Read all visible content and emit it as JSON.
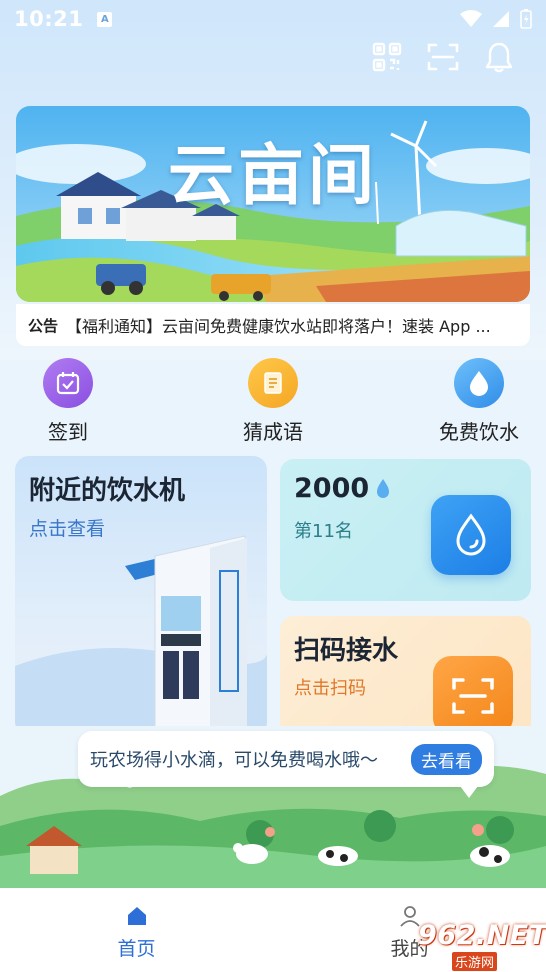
{
  "status_bar": {
    "time": "10:21",
    "notif_badge": "A"
  },
  "header": {
    "icons": [
      "qrcode-icon",
      "scan-icon",
      "bell-icon"
    ]
  },
  "banner": {
    "title": "云亩间"
  },
  "notice": {
    "label": "公告",
    "text": "【福利通知】云亩间免费健康饮水站即将落户！速装 App ..."
  },
  "quick_actions": [
    {
      "label": "签到",
      "icon": "calendar-check-icon",
      "color": "#8e55e0"
    },
    {
      "label": "猜成语",
      "icon": "book-icon",
      "color": "#f5a623"
    },
    {
      "label": "免费饮水",
      "icon": "water-drop-icon",
      "color": "#2f8de8"
    }
  ],
  "cards": {
    "nearby": {
      "title": "附近的饮水机",
      "subtitle": "点击查看"
    },
    "rank": {
      "value": "2000",
      "position": "第11名"
    },
    "scan": {
      "title": "扫码接水",
      "subtitle": "点击扫码"
    }
  },
  "tip": {
    "text": "玩农场得小水滴，可以免费喝水哦～",
    "button": "去看看"
  },
  "tabbar": {
    "tabs": [
      {
        "label": "首页",
        "icon": "home-icon",
        "active": true
      },
      {
        "label": "我的",
        "icon": "user-icon",
        "active": false
      }
    ]
  },
  "watermark": {
    "text": "962.NET",
    "sub": "乐游网"
  },
  "colors": {
    "primary": "#2d6fd6",
    "accent_orange": "#f38518",
    "accent_teal": "#bfeaf2"
  }
}
